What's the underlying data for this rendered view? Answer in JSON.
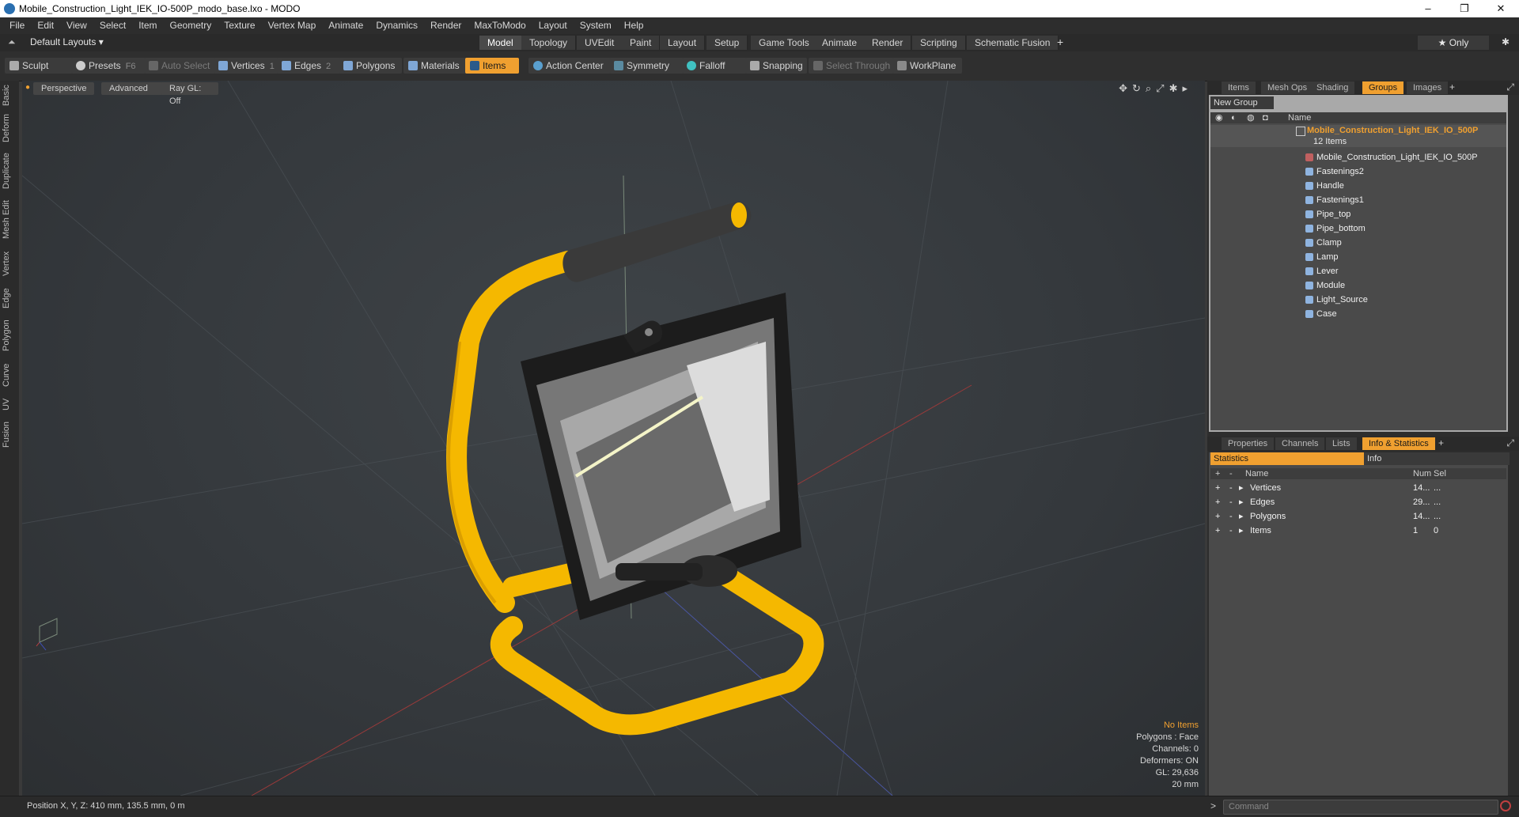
{
  "window": {
    "title": "Mobile_Construction_Light_IEK_IO-500P_modo_base.lxo - MODO",
    "min": "–",
    "max": "❐",
    "close": "✕"
  },
  "menu": [
    "File",
    "Edit",
    "View",
    "Select",
    "Item",
    "Geometry",
    "Texture",
    "Vertex Map",
    "Animate",
    "Dynamics",
    "Render",
    "MaxToModo",
    "Layout",
    "System",
    "Help"
  ],
  "layoutbar": {
    "layouts": "Default Layouts ▾",
    "tabs": [
      "Model",
      "Topology",
      "UVEdit",
      "Paint",
      "Layout",
      "Setup",
      "Game Tools",
      "Animate",
      "Render",
      "Scripting",
      "Schematic Fusion"
    ],
    "active_tab": "Model",
    "add": "+",
    "only": "★ Only",
    "settings": "✱"
  },
  "toolbar": {
    "sculpt": "Sculpt",
    "presets": "Presets",
    "presets_key": "F6",
    "auto_select": "Auto Select",
    "vertices": "Vertices",
    "vertices_key": "1",
    "edges": "Edges",
    "edges_key": "2",
    "polygons": "Polygons",
    "materials": "Materials",
    "items": "Items",
    "action_center": "Action Center",
    "symmetry": "Symmetry",
    "falloff": "Falloff",
    "snapping": "Snapping",
    "select_through": "Select Through",
    "workplane": "WorkPlane"
  },
  "left_tabs": [
    "Basic",
    "Deform",
    "Duplicate",
    "Mesh Edit",
    "Vertex",
    "Edge",
    "Polygon",
    "Curve",
    "UV",
    "Fusion"
  ],
  "viewport": {
    "view": "Perspective",
    "shading": "Advanced",
    "raygl": "Ray GL: Off",
    "info": {
      "items": "No Items",
      "polygons": "Polygons : Face",
      "channels": "Channels: 0",
      "deformers": "Deformers: ON",
      "gl": "GL: 29,636",
      "scale": "20 mm"
    }
  },
  "groups_panel": {
    "tabs": [
      "Items",
      "Mesh Ops",
      "Shading",
      "Groups",
      "Images"
    ],
    "active_tab": "Groups",
    "new_group": "New Group",
    "name_header": "Name",
    "group_name": "Mobile_Construction_Light_IEK_IO_500P",
    "group_count": "12 Items",
    "children": [
      "Mobile_Construction_Light_IEK_IO_500P",
      "Fastenings2",
      "Handle",
      "Fastenings1",
      "Pipe_top",
      "Pipe_bottom",
      "Clamp",
      "Lamp",
      "Lever",
      "Module",
      "Light_Source",
      "Case"
    ]
  },
  "stats_panel": {
    "tabs": [
      "Properties",
      "Channels",
      "Lists",
      "Info & Statistics"
    ],
    "active_tab": "Info & Statistics",
    "subtabs": [
      "Statistics",
      "Info"
    ],
    "headers": {
      "name": "Name",
      "num": "Num",
      "sel": "Sel"
    },
    "rows": [
      {
        "name": "Vertices",
        "num": "14...",
        "sel": "..."
      },
      {
        "name": "Edges",
        "num": "29...",
        "sel": "..."
      },
      {
        "name": "Polygons",
        "num": "14...",
        "sel": "..."
      },
      {
        "name": "Items",
        "num": "1",
        "sel": "0"
      }
    ]
  },
  "status": {
    "position": "Position X, Y, Z:   410 mm, 135.5 mm, 0 m",
    "command_placeholder": "Command"
  },
  "colors": {
    "accent": "#f0a030",
    "frame_yellow": "#f5b800",
    "viewport_bg": "#353a3e"
  }
}
